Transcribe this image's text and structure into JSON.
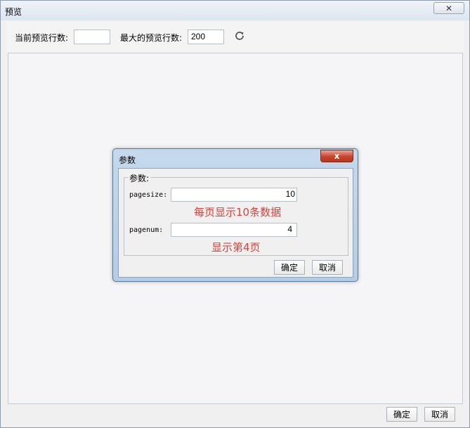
{
  "window": {
    "title": "预览",
    "close_glyph": "✕"
  },
  "toolbar": {
    "current_rows_label": "当前预览行数:",
    "current_rows_value": "",
    "max_rows_label": "最大的预览行数:",
    "max_rows_value": "200",
    "refresh_icon": "refresh-icon"
  },
  "dialog": {
    "title": "参数",
    "close_glyph": "x",
    "group_label": "参数:",
    "params": [
      {
        "label": "pagesize:",
        "value": "10",
        "note": "每页显示10条数据"
      },
      {
        "label": "pagenum:",
        "value": "4",
        "note": "显示第4页"
      }
    ],
    "ok_label": "确定",
    "cancel_label": "取消"
  },
  "footer": {
    "ok_label": "确定",
    "cancel_label": "取消"
  },
  "colors": {
    "annotation": "#e0403a",
    "dialog_frame": "#b3cde6",
    "close_red": "#c9442c"
  }
}
